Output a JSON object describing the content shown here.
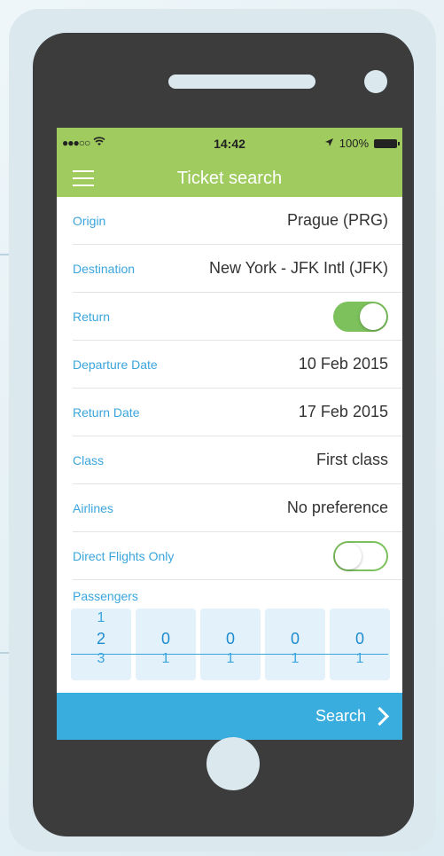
{
  "status": {
    "time": "14:42",
    "battery": "100%"
  },
  "header": {
    "title": "Ticket search"
  },
  "form": {
    "origin": {
      "label": "Origin",
      "value": "Prague (PRG)"
    },
    "destination": {
      "label": "Destination",
      "value": "New York - JFK Intl (JFK)"
    },
    "return": {
      "label": "Return",
      "enabled": true
    },
    "departure_date": {
      "label": "Departure Date",
      "value": "10 Feb 2015"
    },
    "return_date": {
      "label": "Return Date",
      "value": "17 Feb 2015"
    },
    "class": {
      "label": "Class",
      "value": "First class"
    },
    "airlines": {
      "label": "Airlines",
      "value": "No preference"
    },
    "direct_only": {
      "label": "Direct Flights Only",
      "enabled": false
    },
    "passengers": {
      "label": "Passengers",
      "pickers": [
        {
          "above": "1",
          "selected": "2",
          "below": "3"
        },
        {
          "selected": "0",
          "below": "1"
        },
        {
          "selected": "0",
          "below": "1"
        },
        {
          "selected": "0",
          "below": "1"
        },
        {
          "selected": "0",
          "below": "1"
        }
      ]
    }
  },
  "actions": {
    "search_label": "Search"
  },
  "colors": {
    "green": "#9fcb5f",
    "blue": "#3aaddf",
    "label_blue": "#3aa5dc",
    "toggle_green": "#7cc15c"
  }
}
